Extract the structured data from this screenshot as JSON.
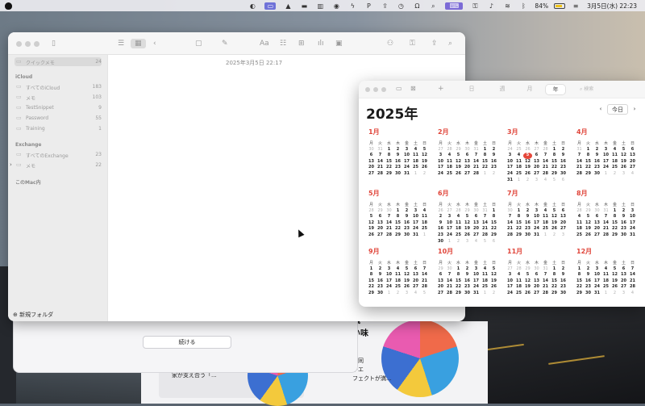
{
  "menubar": {
    "battery": "84%",
    "datetime": "3月5日(水) 22:23"
  },
  "notes": {
    "sidebar": {
      "quick_notes": {
        "label": "クイックメモ",
        "count": "24"
      },
      "sections": [
        {
          "header": "iCloud",
          "items": [
            {
              "label": "すべてのiCloud",
              "count": "183"
            },
            {
              "label": "メモ",
              "count": "103"
            },
            {
              "label": "TestSnippet",
              "count": "9"
            },
            {
              "label": "Password",
              "count": "55"
            },
            {
              "label": "Training",
              "count": "1"
            }
          ]
        },
        {
          "header": "Exchange",
          "items": [
            {
              "label": "すべてのExchange",
              "count": "23"
            },
            {
              "label": "メモ",
              "count": "22"
            }
          ]
        },
        {
          "header": "このMac内",
          "items": []
        }
      ],
      "new_folder": "新規フォルダ"
    },
    "note_date": "2025年3月5日 22:17"
  },
  "dialog": {
    "continue_label": "続ける"
  },
  "background_app": {
    "card1_text": "家が支え合う「...",
    "side_title_1": "議",
    "side_title_2": "い味",
    "side_text_1": "も同",
    "side_text_2": "やエ",
    "side_text_3": "フェクトが満..."
  },
  "calendar": {
    "view_tabs": [
      "日",
      "週",
      "月",
      "年"
    ],
    "active_view": "年",
    "search_placeholder": "検索",
    "year_title": "2025年",
    "today_label": "今日",
    "weekday_headers": [
      "月",
      "火",
      "水",
      "木",
      "金",
      "土",
      "日"
    ],
    "today": {
      "month": 3,
      "day": 5
    },
    "months": [
      {
        "name": "1月",
        "lead": [
          30,
          31
        ],
        "days": 31
      },
      {
        "name": "2月",
        "lead": [
          27,
          28,
          29,
          30,
          31
        ],
        "days": 28
      },
      {
        "name": "3月",
        "lead": [
          24,
          25,
          26,
          27,
          28
        ],
        "days": 31
      },
      {
        "name": "4月",
        "lead": [
          31
        ],
        "days": 30
      },
      {
        "name": "5月",
        "lead": [
          28,
          29,
          30
        ],
        "days": 31
      },
      {
        "name": "6月",
        "lead": [
          26,
          27,
          28,
          29,
          30,
          31
        ],
        "days": 30
      },
      {
        "name": "7月",
        "lead": [
          30
        ],
        "days": 31
      },
      {
        "name": "8月",
        "lead": [
          28,
          29,
          30,
          31
        ],
        "days": 31
      },
      {
        "name": "9月",
        "lead": [],
        "days": 30
      },
      {
        "name": "10月",
        "lead": [
          29,
          30
        ],
        "days": 31
      },
      {
        "name": "11月",
        "lead": [
          27,
          28,
          29,
          30,
          31
        ],
        "days": 30
      },
      {
        "name": "12月",
        "lead": [],
        "days": 31
      }
    ],
    "colors": {
      "accent": "#e5473a"
    }
  }
}
